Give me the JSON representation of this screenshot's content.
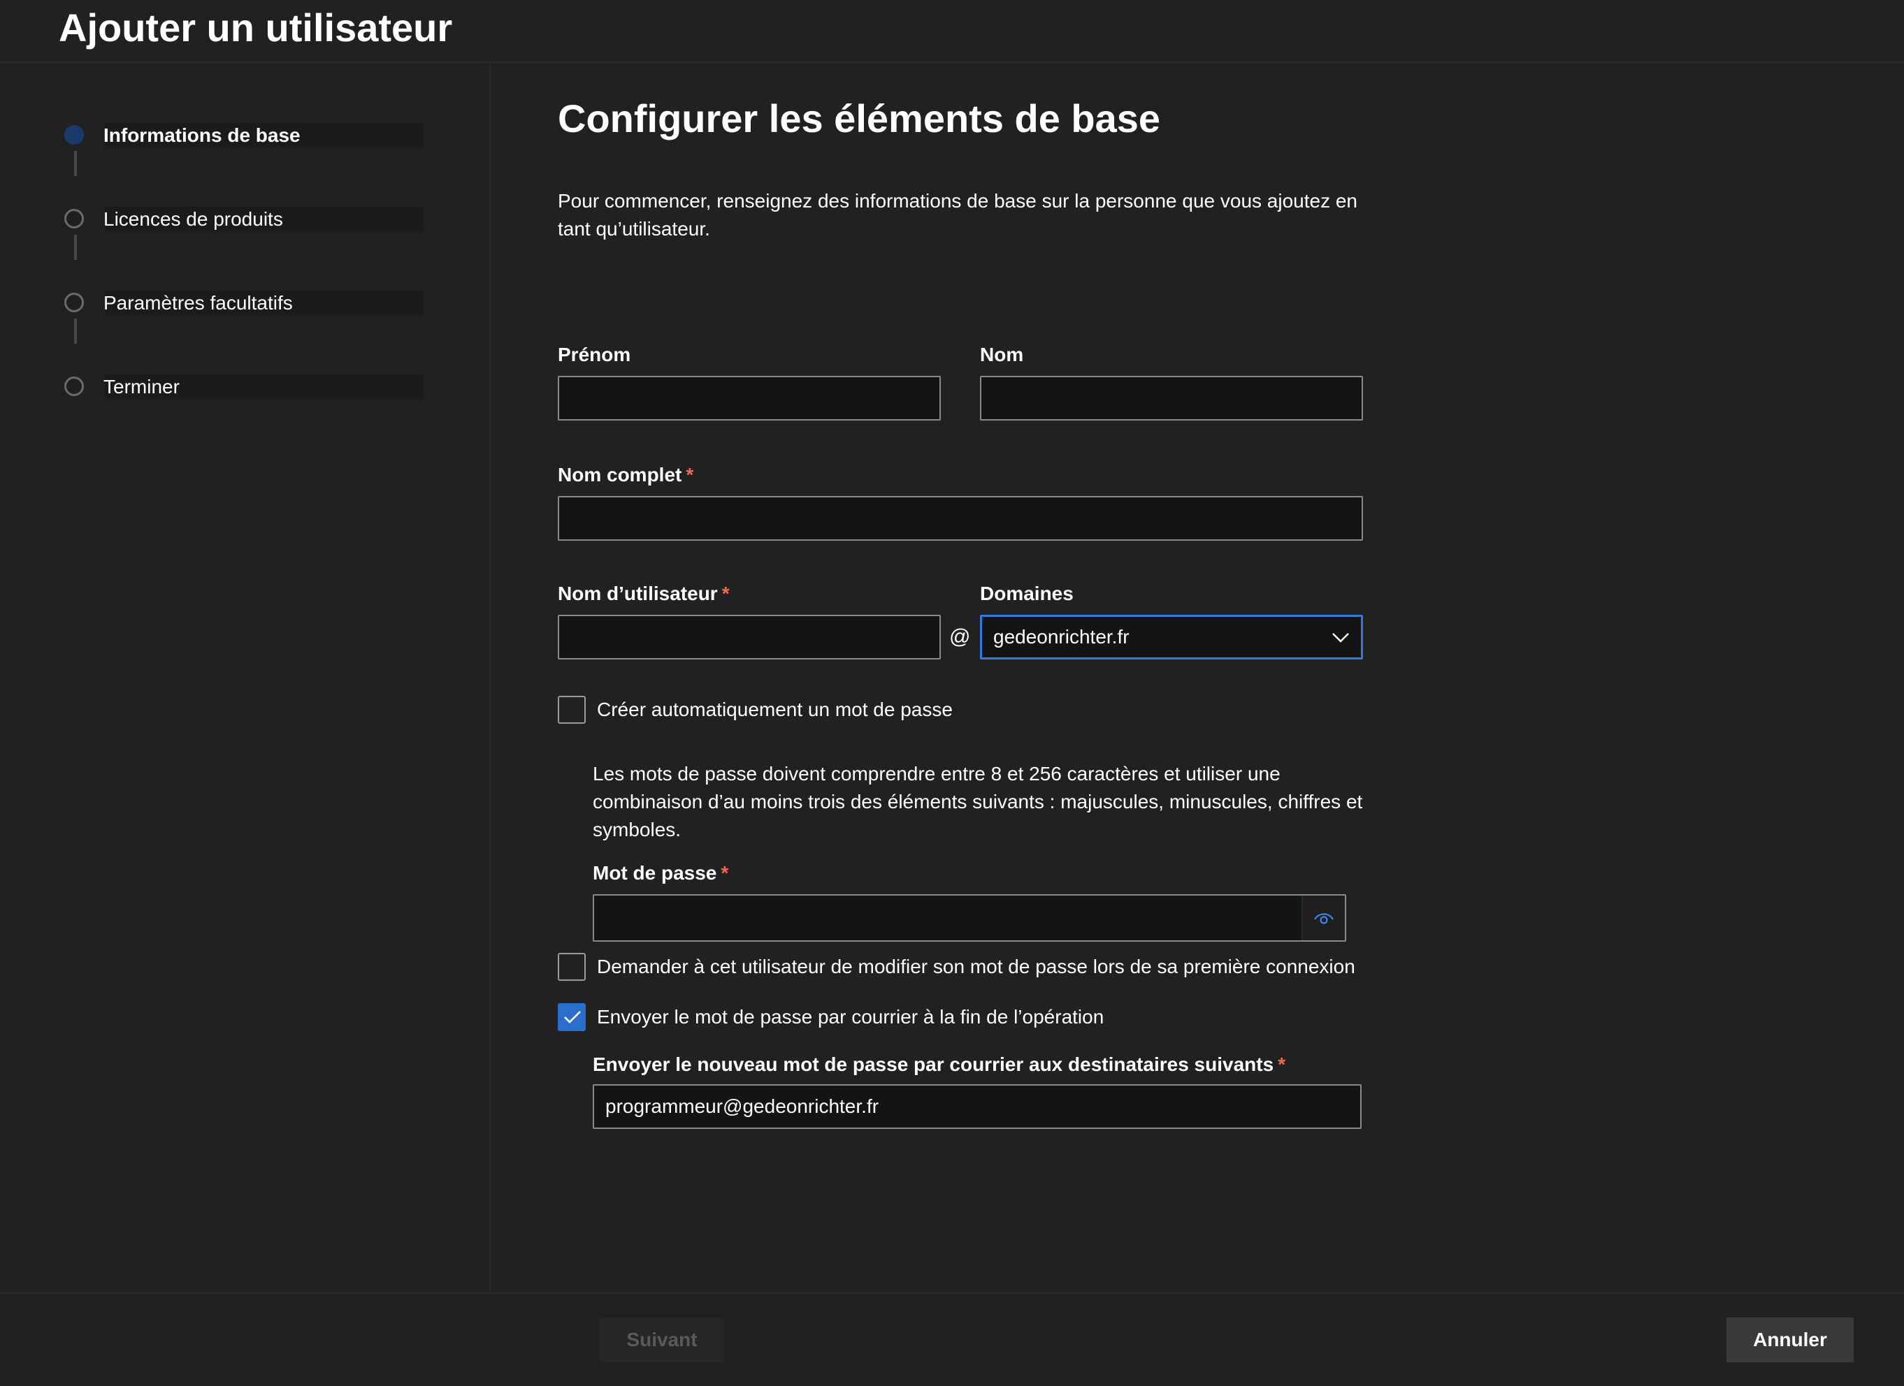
{
  "header": {
    "title": "Ajouter un utilisateur"
  },
  "steps": [
    {
      "label": "Informations de base",
      "state": "active"
    },
    {
      "label": "Licences de produits",
      "state": "pending"
    },
    {
      "label": "Paramètres facultatifs",
      "state": "pending"
    },
    {
      "label": "Terminer",
      "state": "pending"
    }
  ],
  "main": {
    "title": "Configurer les éléments de base",
    "intro": "Pour commencer, renseignez des informations de base sur la personne que vous ajoutez en tant qu’utilisateur.",
    "first_name": {
      "label": "Prénom",
      "value": ""
    },
    "last_name": {
      "label": "Nom",
      "value": ""
    },
    "full_name": {
      "label": "Nom complet",
      "required_mark": "*",
      "value": ""
    },
    "username": {
      "label": "Nom d’utilisateur",
      "required_mark": "*",
      "value": "",
      "at": "@"
    },
    "domains": {
      "label": "Domaines",
      "selected": "gedeonrichter.fr"
    },
    "auto_password": {
      "label": "Créer automatiquement un mot de passe",
      "checked": false
    },
    "password_helper": "Les mots de passe doivent comprendre entre 8 et 256 caractères et utiliser une combinaison d’au moins trois des éléments suivants : majuscules, minuscules, chiffres et symboles.",
    "password": {
      "label": "Mot de passe",
      "required_mark": "*",
      "value": "",
      "icon": "eye-icon"
    },
    "require_change": {
      "label": "Demander à cet utilisateur de modifier son mot de passe lors de sa première connexion",
      "checked": false
    },
    "email_password": {
      "label": "Envoyer le mot de passe par courrier à la fin de l’opération",
      "checked": true
    },
    "recipients": {
      "label": "Envoyer le nouveau mot de passe par courrier aux destinataires suivants",
      "required_mark": "*",
      "value": "programmeur@gedeonrichter.fr"
    }
  },
  "footer": {
    "next_label": "Suivant",
    "cancel_label": "Annuler"
  },
  "colors": {
    "background": "#212121",
    "accent": "#2f7be0",
    "required": "#ef6950",
    "active_step": "#1a3a6b"
  }
}
